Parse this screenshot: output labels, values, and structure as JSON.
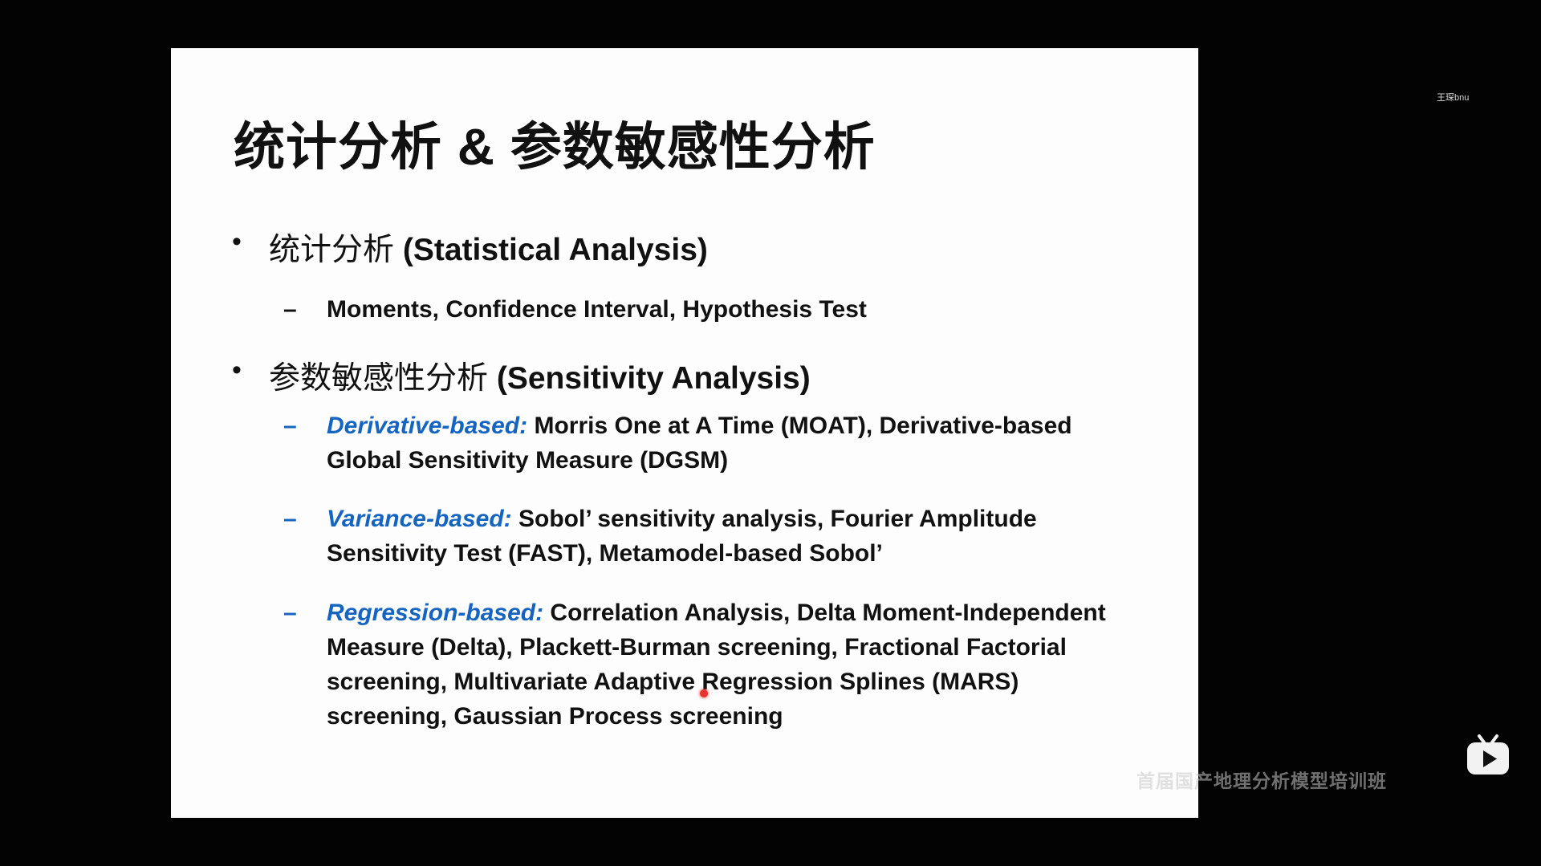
{
  "slide": {
    "title": "统计分析 & 参数敏感性分析",
    "bullets": [
      {
        "zh": "统计分析",
        "en": "(Statistical Analysis)"
      },
      {
        "zh": "参数敏感性分析",
        "en": "(Sensitivity Analysis)"
      }
    ],
    "subitems": [
      {
        "dash": "–",
        "lead": "",
        "text": "Moments, Confidence Interval, Hypothesis Test"
      },
      {
        "dash": "–",
        "lead": "Derivative-based:",
        "text": "Morris One at A Time (MOAT), Derivative-based Global Sensitivity Measure (DGSM)"
      },
      {
        "dash": "–",
        "lead": "Variance-based:",
        "text": "Sobol’ sensitivity analysis, Fourier Amplitude Sensitivity Test (FAST), Metamodel-based Sobol’"
      },
      {
        "dash": "–",
        "lead": "Regression-based:",
        "text": "Correlation Analysis, Delta Moment-Independent Measure (Delta), Plackett-Burman screening, Fractional Factorial screening, Multivariate Adaptive Regression Splines (MARS) screening, Gaussian Process screening"
      }
    ],
    "bullet_symbol": "•"
  },
  "overlay": {
    "username": "王琛bnu",
    "watermark": "首届国产地理分析模型培训班"
  },
  "colors": {
    "accent_blue": "#1565c0",
    "slide_bg": "#fdfdfd",
    "screen_bg": "#030303",
    "cursor": "#e8322d"
  },
  "icons": {
    "player_logo": "bilibili-tv-icon"
  }
}
